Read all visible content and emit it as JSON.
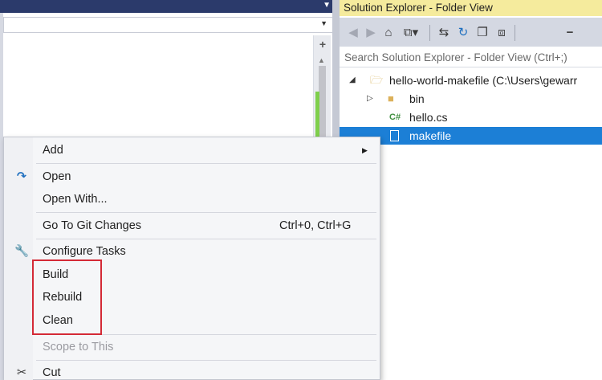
{
  "solution_explorer": {
    "title": "Solution Explorer - Folder View",
    "search_placeholder": "Search Solution Explorer - Folder View (Ctrl+;)",
    "toolbar_icons": [
      "back-icon",
      "forward-icon",
      "home-icon",
      "switch-views-icon",
      "sync-icon",
      "refresh-icon",
      "collapse-all-icon",
      "show-all-files-icon",
      "properties-icon"
    ],
    "tree": [
      {
        "label": "hello-world-makefile (C:\\Users\\gewarr",
        "icon": "folder-open-icon",
        "expanded": true
      },
      {
        "label": "bin",
        "icon": "folder-icon",
        "expanded": false
      },
      {
        "label": "hello.cs",
        "icon": "csharp-file-icon"
      },
      {
        "label": "makefile",
        "icon": "file-icon",
        "selected": true
      }
    ]
  },
  "context_menu": {
    "items": [
      {
        "label": "Add",
        "submenu": true
      },
      {
        "label": "Open",
        "icon": "open-arrow-icon"
      },
      {
        "label": "Open With..."
      },
      {
        "label": "Go To Git Changes",
        "shortcut": "Ctrl+0, Ctrl+G"
      },
      {
        "label": "Configure Tasks",
        "icon": "wrench-icon"
      },
      {
        "label": "Build"
      },
      {
        "label": "Rebuild"
      },
      {
        "label": "Clean"
      },
      {
        "label": "Scope to This",
        "disabled": true
      },
      {
        "label": "Cut",
        "icon": "scissors-icon"
      }
    ]
  },
  "colors": {
    "selection": "#1c7fd6",
    "highlight_box": "#d42a36",
    "se_title_bg": "#f5eb9d"
  }
}
